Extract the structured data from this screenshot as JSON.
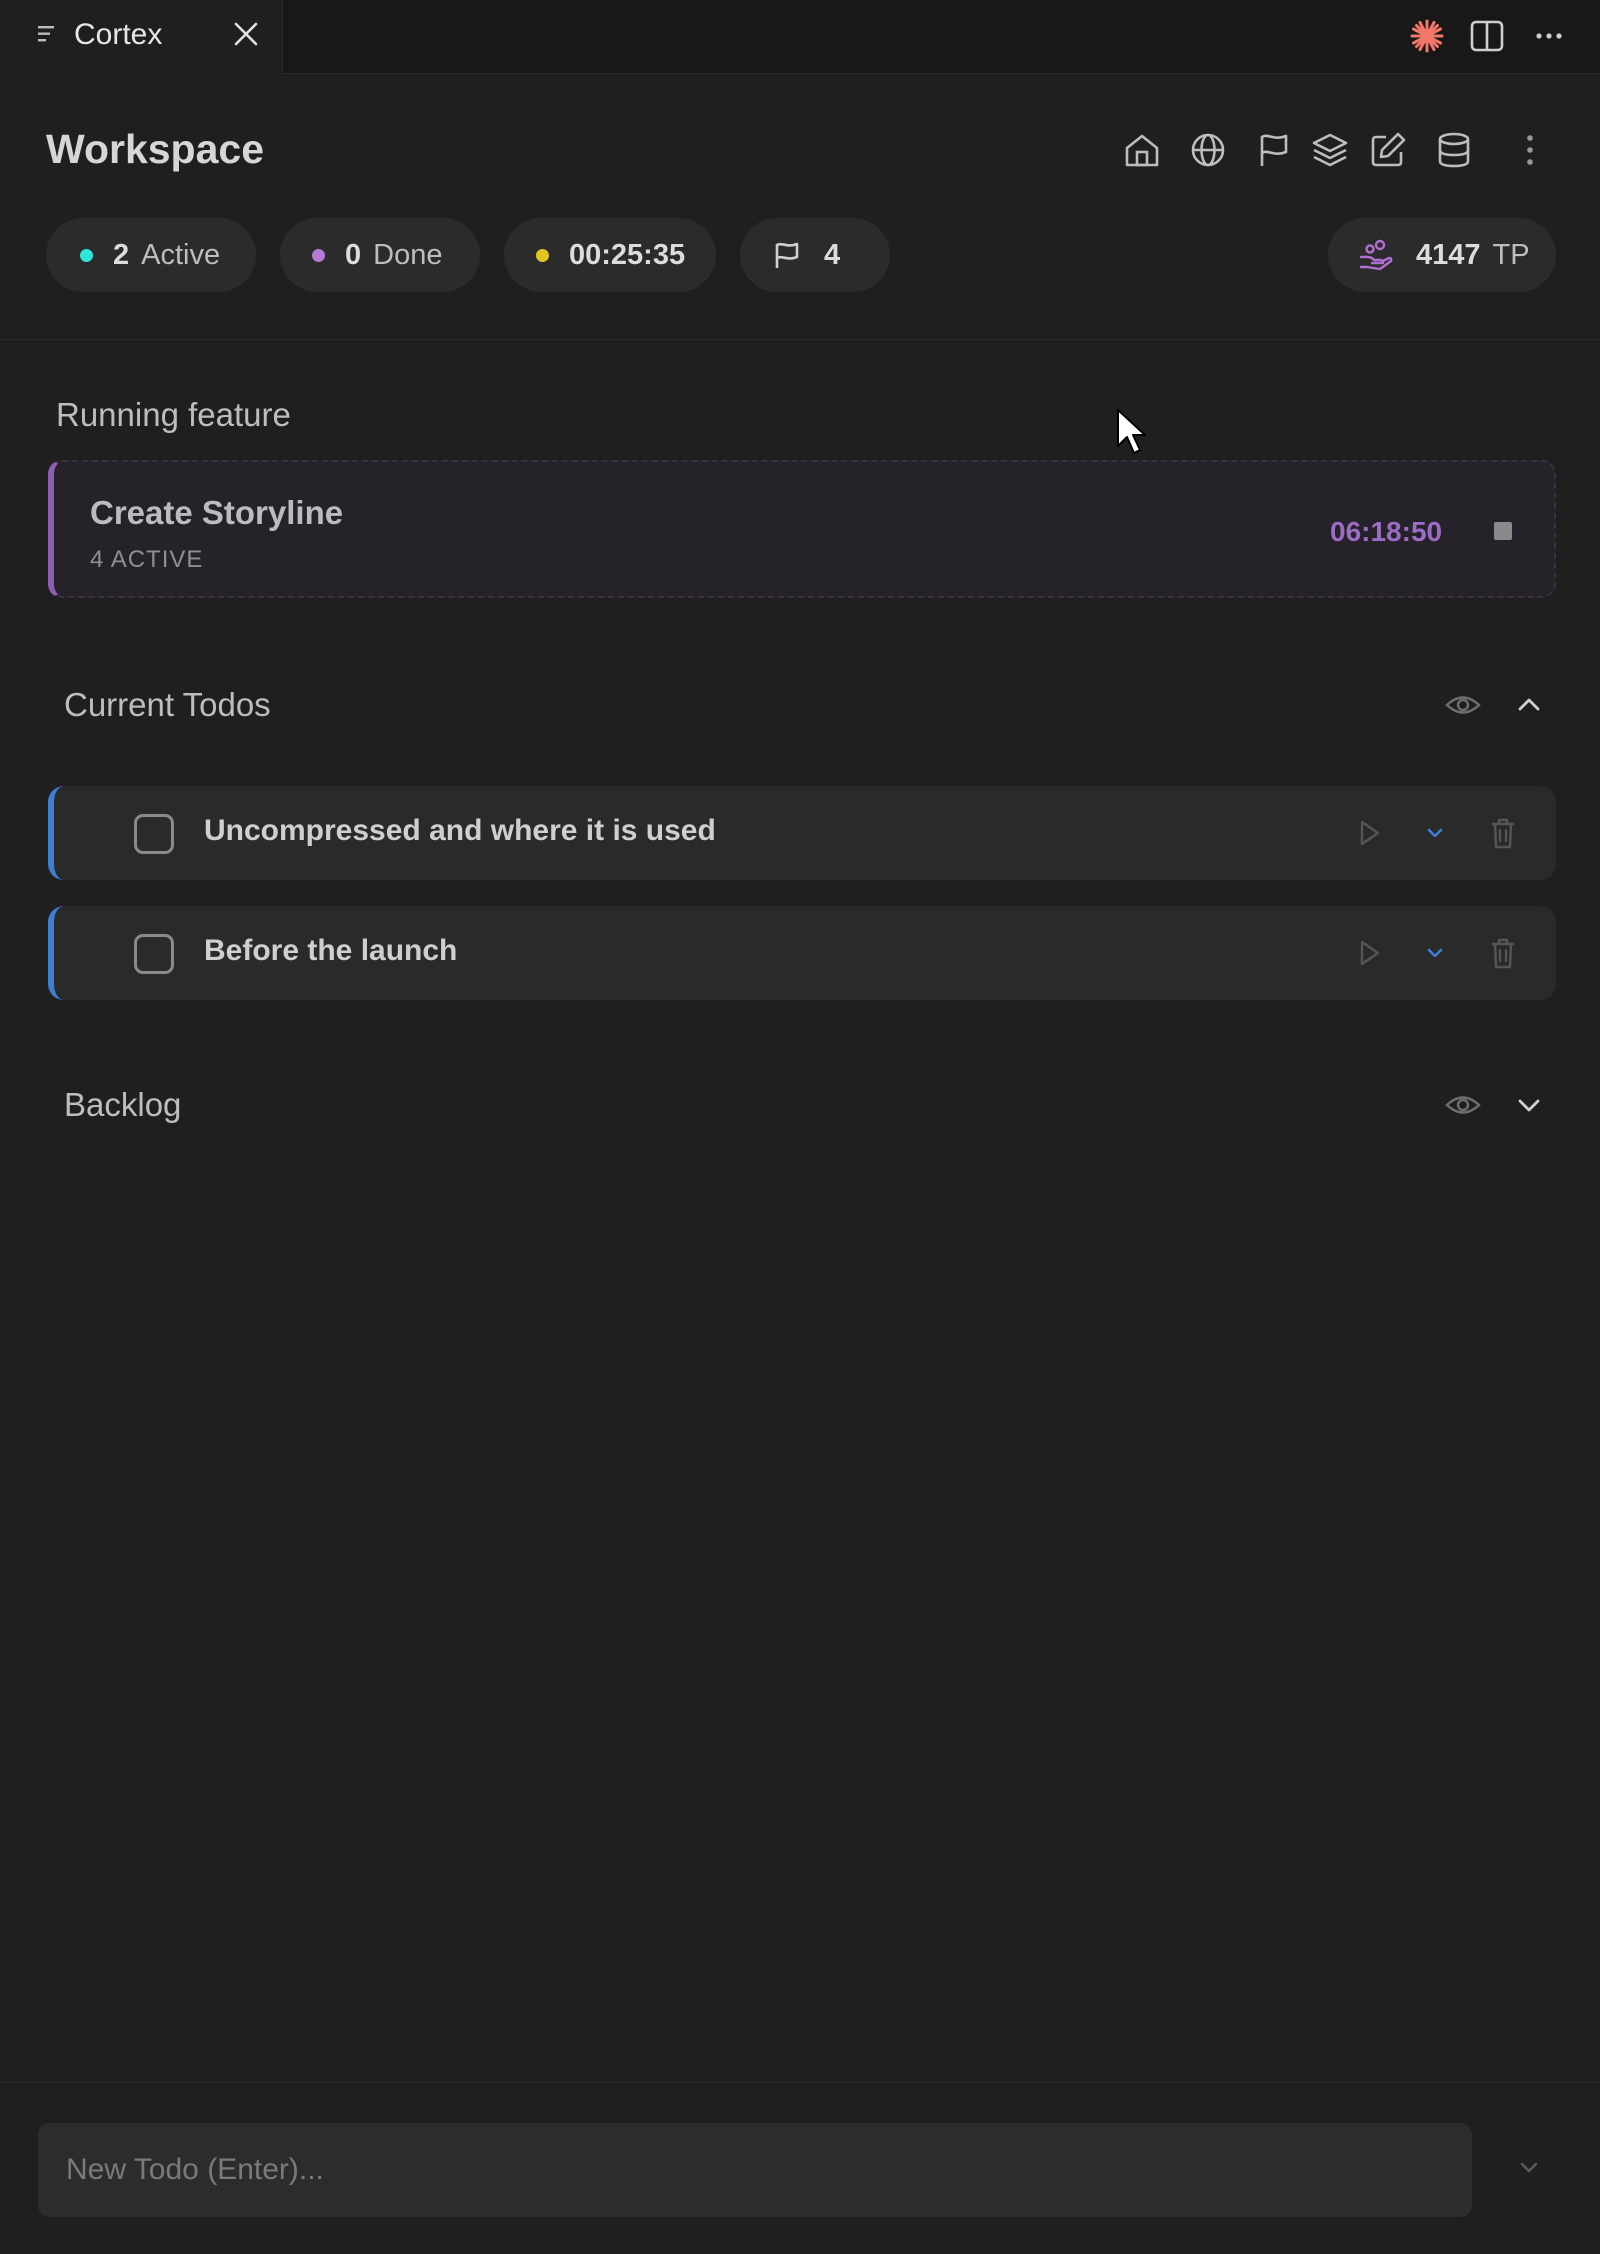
{
  "tab": {
    "title": "Cortex"
  },
  "header": {
    "title": "Workspace",
    "pills": {
      "active": {
        "count": "2",
        "label": "Active",
        "color": "#2ee6d6"
      },
      "done": {
        "count": "0",
        "label": "Done",
        "color": "#b57bd6"
      },
      "timer": {
        "value": "00:25:35",
        "color": "#e2c421"
      },
      "flags": {
        "count": "4"
      },
      "points": {
        "value": "4147",
        "unit": "TP",
        "color": "#b06fd3"
      }
    },
    "icons": [
      "home-icon",
      "globe-icon",
      "flag-icon",
      "layers-icon",
      "edit-icon",
      "database-icon",
      "more-vertical-icon"
    ]
  },
  "running_feature": {
    "section_label": "Running feature",
    "title": "Create Storyline",
    "subtitle": "4 ACTIVE",
    "timer": "06:18:50"
  },
  "current_todos": {
    "section_label": "Current Todos",
    "items": [
      {
        "text": "Uncompressed and where it is used"
      },
      {
        "text": "Before the launch"
      }
    ]
  },
  "backlog": {
    "section_label": "Backlog"
  },
  "footer": {
    "placeholder": "New Todo (Enter)..."
  },
  "colors": {
    "accent_blue": "#3f7fd6",
    "accent_purple": "#8c5fb4",
    "spark": "#f0776a"
  }
}
